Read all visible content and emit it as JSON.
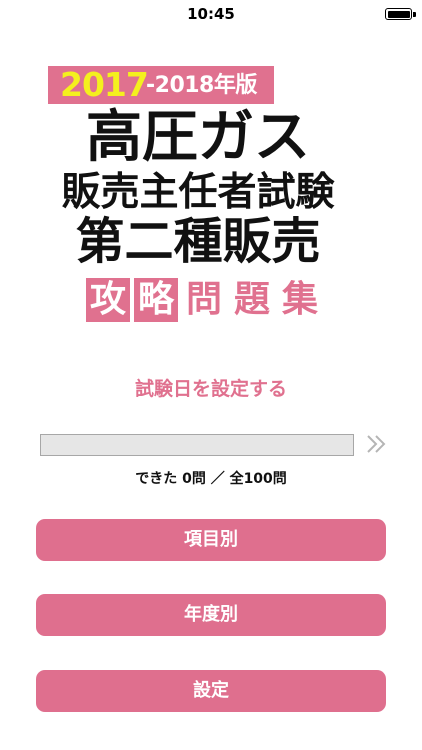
{
  "status_bar": {
    "time": "10:45",
    "battery_level": 1.0
  },
  "logo": {
    "year_main": "2017",
    "year_sub": "-2018年版",
    "title_line1": "高圧ガス",
    "title_line2": "販売主任者試験",
    "title_line3": "第二種販売",
    "subtitle_chars": [
      "攻",
      "略",
      "問",
      "題",
      "集"
    ],
    "accent_color": "#e0718f",
    "year_color": "#f4f01e"
  },
  "exam_date_link": "試験日を設定する",
  "progress": {
    "done": 0,
    "total": 100,
    "label": "できた 0問 ／ 全100問",
    "arrow_icon": "double-chevron-right-icon"
  },
  "buttons": {
    "by_item": "項目別",
    "by_year": "年度別",
    "settings": "設定"
  },
  "colors": {
    "accent": "#df6f8e",
    "background": "#ffffff"
  }
}
